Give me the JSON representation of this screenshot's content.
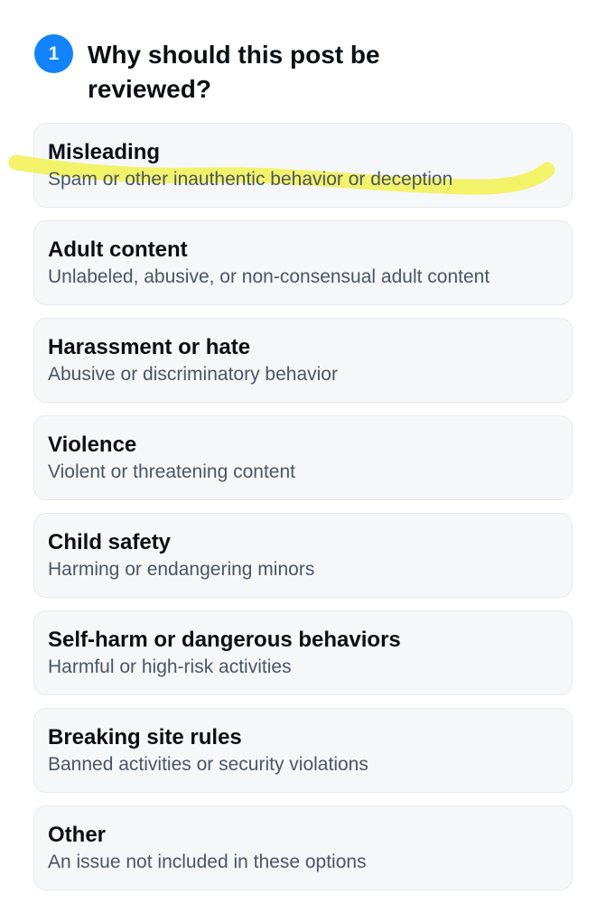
{
  "header": {
    "step_number": "1",
    "title": "Why should this post be reviewed?"
  },
  "options": [
    {
      "title": "Misleading",
      "description": "Spam or other inauthentic behavior or deception"
    },
    {
      "title": "Adult content",
      "description": "Unlabeled, abusive, or non-consensual adult content"
    },
    {
      "title": "Harassment or hate",
      "description": "Abusive or discriminatory behavior"
    },
    {
      "title": "Violence",
      "description": "Violent or threatening content"
    },
    {
      "title": "Child safety",
      "description": "Harming or endangering minors"
    },
    {
      "title": "Self-harm or dangerous behaviors",
      "description": "Harmful or high-risk activities"
    },
    {
      "title": "Breaking site rules",
      "description": "Banned activities or security violations"
    },
    {
      "title": "Other",
      "description": "An issue not included in these options"
    }
  ],
  "colors": {
    "accent": "#1183fe",
    "card_background": "#f6f7f9",
    "description_text": "#4a5566",
    "highlight_marker": "#f3f25a"
  }
}
